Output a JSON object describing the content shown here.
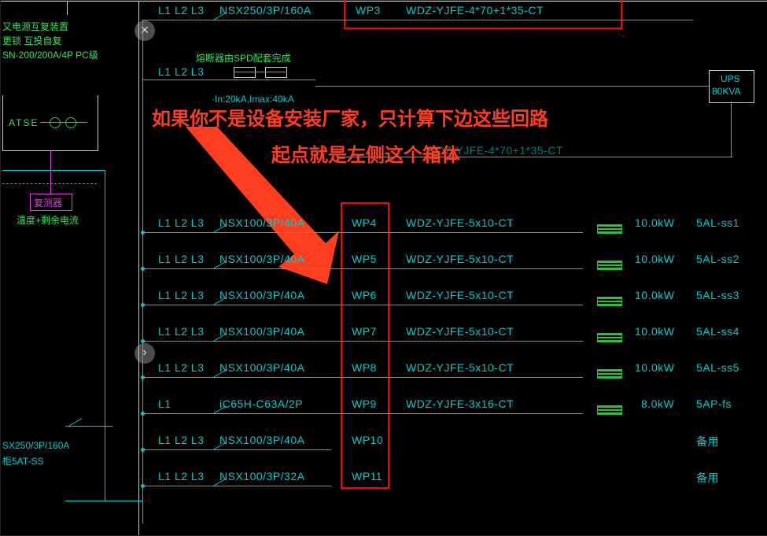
{
  "header": {
    "left_notes": [
      "又电源互复装置",
      "更锁 互投自复",
      "SN-200/200A/4P PC级"
    ],
    "atse_label": "ATSE",
    "ups": {
      "name": "UPS",
      "kva": "80KVA"
    },
    "spd_note": "熔断器由SPD配套完成",
    "spd_sub": "·In:20kA,Imax:40kA",
    "monitor_box": "复测器",
    "monitor_note": "温度+剩余电流",
    "row0_lines": "L1 L2 L3",
    "row0_breaker": "NSX250/3P/160A",
    "row0_id": "WP3",
    "row0_cable": "WDZ-YJFE-4*70+1*35-CT",
    "row_spd_lines": "L1 L2 L3",
    "wp_after_ups": "WDZ-YJFE-4*70+1*35-CT"
  },
  "annotation": {
    "line1": "如果你不是设备安装厂家，只计算下边这些回路",
    "line2": "起点就是左侧这个箱体"
  },
  "rows": [
    {
      "lines": "L1 L2 L3",
      "breaker": "NSX100/3P/40A",
      "id": "WP4",
      "cable": "WDZ-YJFE-5x10-CT",
      "load": "10.0kW",
      "dest": "5AL-ss1"
    },
    {
      "lines": "L1 L2 L3",
      "breaker": "NSX100/3P/40A",
      "id": "WP5",
      "cable": "WDZ-YJFE-5x10-CT",
      "load": "10.0kW",
      "dest": "5AL-ss2"
    },
    {
      "lines": "L1 L2 L3",
      "breaker": "NSX100/3P/40A",
      "id": "WP6",
      "cable": "WDZ-YJFE-5x10-CT",
      "load": "10.0kW",
      "dest": "5AL-ss3"
    },
    {
      "lines": "L1 L2 L3",
      "breaker": "NSX100/3P/40A",
      "id": "WP7",
      "cable": "WDZ-YJFE-5x10-CT",
      "load": "10.0kW",
      "dest": "5AL-ss4"
    },
    {
      "lines": "L1 L2 L3",
      "breaker": "NSX100/3P/40A",
      "id": "WP8",
      "cable": "WDZ-YJFE-5x10-CT",
      "load": "10.0kW",
      "dest": "5AL-ss5"
    },
    {
      "lines": "L1",
      "breaker": "iC65H-C63A/2P",
      "id": "WP9",
      "cable": "WDZ-YJFE-3x16-CT",
      "load": "8.0kW",
      "dest": "5AP-fs"
    },
    {
      "lines": "L1 L2 L3",
      "breaker": "NSX100/3P/40A",
      "id": "WP10",
      "cable": "",
      "load": "",
      "dest": "备用"
    },
    {
      "lines": "L1 L2 L3",
      "breaker": "NSX100/3P/32A",
      "id": "WP11",
      "cable": "",
      "load": "",
      "dest": "备用"
    }
  ],
  "bottom_left": {
    "breaker": "SX250/3P/160A",
    "panel": "柜5AT-SS"
  }
}
